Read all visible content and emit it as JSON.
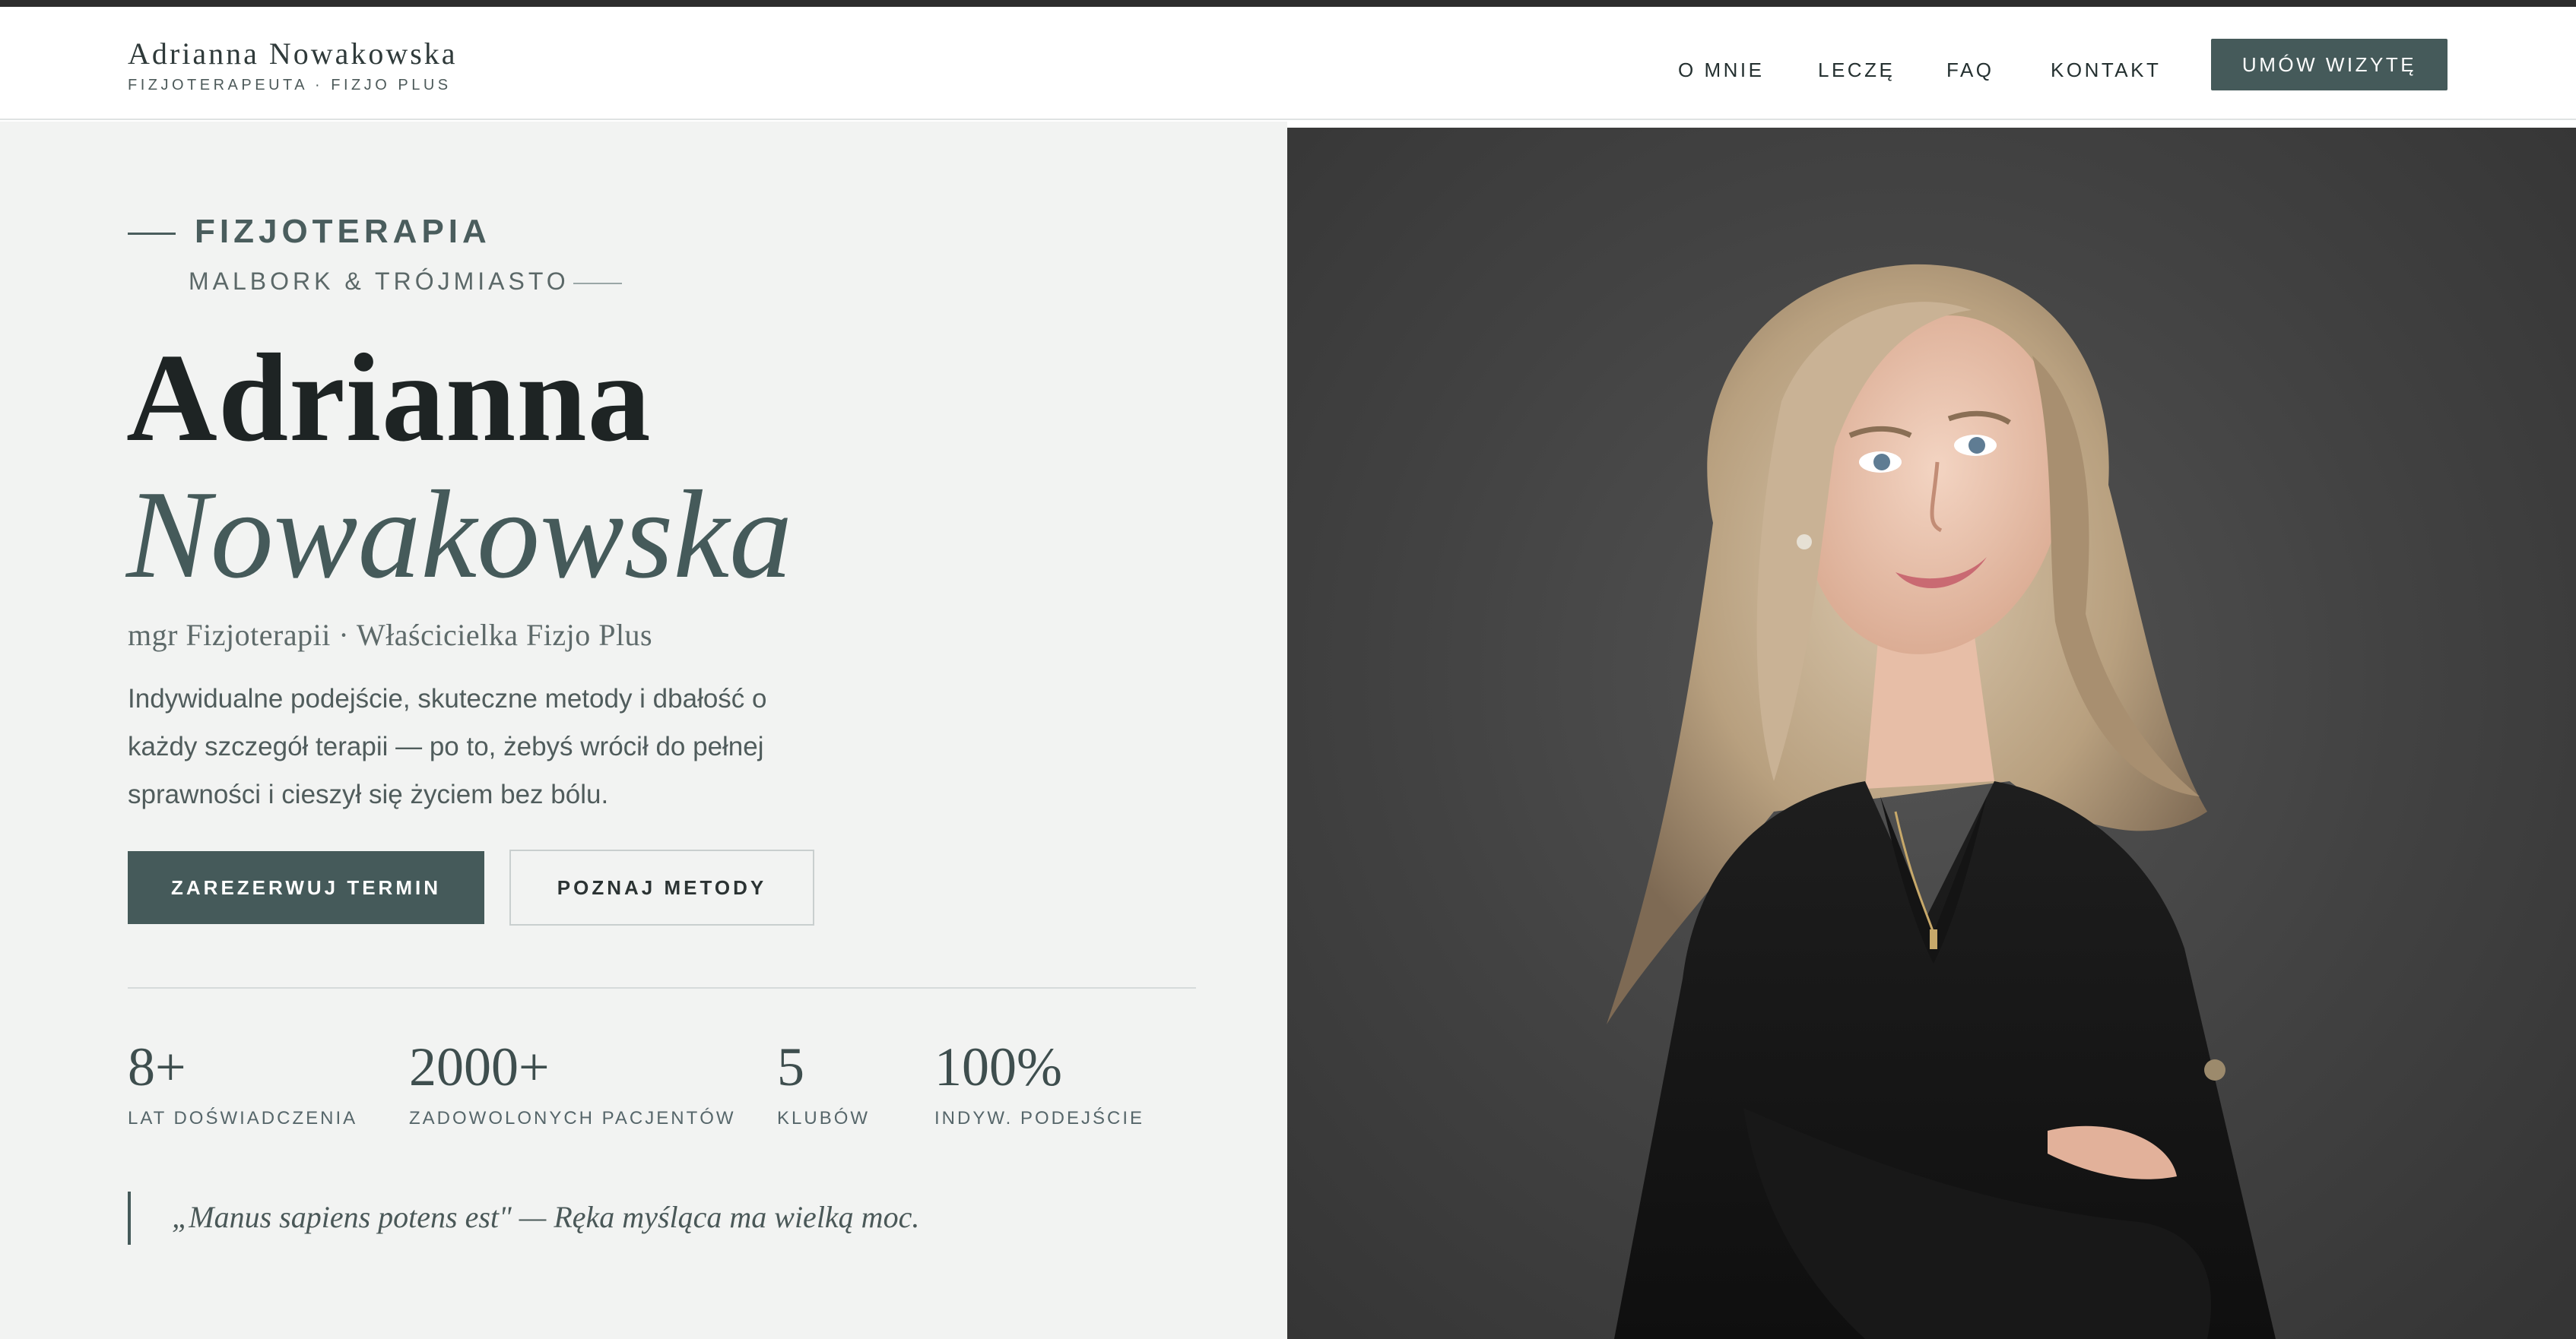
{
  "header": {
    "brand_name": "Adrianna Nowakowska",
    "brand_sub": "FIZJOTERAPEUTA · FIZJO PLUS",
    "nav": [
      {
        "label": "O MNIE"
      },
      {
        "label": "LECZĘ"
      },
      {
        "label": "FAQ"
      },
      {
        "label": "KONTAKT"
      }
    ],
    "cta_label": "UMÓW WIZYTĘ"
  },
  "hero": {
    "eyebrow": "FIZJOTERAPIA",
    "location": "MALBORK & TRÓJMIASTO",
    "first_name": "Adrianna",
    "last_name": "Nowakowska",
    "subtitle": "mgr Fizjoterapii · Właścicielka Fizjo Plus",
    "lead": "Indywidualne podejście, skuteczne metody i dbałość o każdy szczegół terapii — po to, żebyś wrócił do pełnej sprawności i cieszył się życiem bez bólu.",
    "primary_button": "ZAREZERWUJ TERMIN",
    "secondary_button": "POZNAJ METODY"
  },
  "stats": [
    {
      "value": "8+",
      "label": "LAT DOŚWIADCZENIA"
    },
    {
      "value": "2000+",
      "label": "ZADOWOLONYCH PACJENTÓW"
    },
    {
      "value": "5",
      "label": "KLUBÓW"
    },
    {
      "value": "100%",
      "label": "INDYW. PODEJŚCIE"
    }
  ],
  "quote": "„Manus sapiens potens est\" — Ręka myśląca ma wielką moc.",
  "colors": {
    "accent": "#455a5a",
    "left_background": "#f2f3f2",
    "photo_background": "#424242",
    "text_dark": "#1e2424"
  }
}
